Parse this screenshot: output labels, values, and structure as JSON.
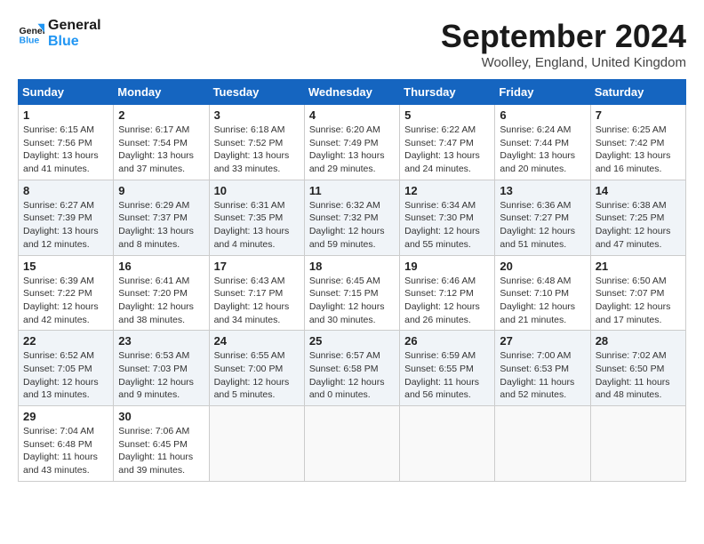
{
  "logo": {
    "line1": "General",
    "line2": "Blue"
  },
  "title": "September 2024",
  "location": "Woolley, England, United Kingdom",
  "days_of_week": [
    "Sunday",
    "Monday",
    "Tuesday",
    "Wednesday",
    "Thursday",
    "Friday",
    "Saturday"
  ],
  "weeks": [
    [
      {
        "day": "1",
        "sunrise": "6:15 AM",
        "sunset": "7:56 PM",
        "daylight": "13 hours and 41 minutes."
      },
      {
        "day": "2",
        "sunrise": "6:17 AM",
        "sunset": "7:54 PM",
        "daylight": "13 hours and 37 minutes."
      },
      {
        "day": "3",
        "sunrise": "6:18 AM",
        "sunset": "7:52 PM",
        "daylight": "13 hours and 33 minutes."
      },
      {
        "day": "4",
        "sunrise": "6:20 AM",
        "sunset": "7:49 PM",
        "daylight": "13 hours and 29 minutes."
      },
      {
        "day": "5",
        "sunrise": "6:22 AM",
        "sunset": "7:47 PM",
        "daylight": "13 hours and 24 minutes."
      },
      {
        "day": "6",
        "sunrise": "6:24 AM",
        "sunset": "7:44 PM",
        "daylight": "13 hours and 20 minutes."
      },
      {
        "day": "7",
        "sunrise": "6:25 AM",
        "sunset": "7:42 PM",
        "daylight": "13 hours and 16 minutes."
      }
    ],
    [
      {
        "day": "8",
        "sunrise": "6:27 AM",
        "sunset": "7:39 PM",
        "daylight": "13 hours and 12 minutes."
      },
      {
        "day": "9",
        "sunrise": "6:29 AM",
        "sunset": "7:37 PM",
        "daylight": "13 hours and 8 minutes."
      },
      {
        "day": "10",
        "sunrise": "6:31 AM",
        "sunset": "7:35 PM",
        "daylight": "13 hours and 4 minutes."
      },
      {
        "day": "11",
        "sunrise": "6:32 AM",
        "sunset": "7:32 PM",
        "daylight": "12 hours and 59 minutes."
      },
      {
        "day": "12",
        "sunrise": "6:34 AM",
        "sunset": "7:30 PM",
        "daylight": "12 hours and 55 minutes."
      },
      {
        "day": "13",
        "sunrise": "6:36 AM",
        "sunset": "7:27 PM",
        "daylight": "12 hours and 51 minutes."
      },
      {
        "day": "14",
        "sunrise": "6:38 AM",
        "sunset": "7:25 PM",
        "daylight": "12 hours and 47 minutes."
      }
    ],
    [
      {
        "day": "15",
        "sunrise": "6:39 AM",
        "sunset": "7:22 PM",
        "daylight": "12 hours and 42 minutes."
      },
      {
        "day": "16",
        "sunrise": "6:41 AM",
        "sunset": "7:20 PM",
        "daylight": "12 hours and 38 minutes."
      },
      {
        "day": "17",
        "sunrise": "6:43 AM",
        "sunset": "7:17 PM",
        "daylight": "12 hours and 34 minutes."
      },
      {
        "day": "18",
        "sunrise": "6:45 AM",
        "sunset": "7:15 PM",
        "daylight": "12 hours and 30 minutes."
      },
      {
        "day": "19",
        "sunrise": "6:46 AM",
        "sunset": "7:12 PM",
        "daylight": "12 hours and 26 minutes."
      },
      {
        "day": "20",
        "sunrise": "6:48 AM",
        "sunset": "7:10 PM",
        "daylight": "12 hours and 21 minutes."
      },
      {
        "day": "21",
        "sunrise": "6:50 AM",
        "sunset": "7:07 PM",
        "daylight": "12 hours and 17 minutes."
      }
    ],
    [
      {
        "day": "22",
        "sunrise": "6:52 AM",
        "sunset": "7:05 PM",
        "daylight": "12 hours and 13 minutes."
      },
      {
        "day": "23",
        "sunrise": "6:53 AM",
        "sunset": "7:03 PM",
        "daylight": "12 hours and 9 minutes."
      },
      {
        "day": "24",
        "sunrise": "6:55 AM",
        "sunset": "7:00 PM",
        "daylight": "12 hours and 5 minutes."
      },
      {
        "day": "25",
        "sunrise": "6:57 AM",
        "sunset": "6:58 PM",
        "daylight": "12 hours and 0 minutes."
      },
      {
        "day": "26",
        "sunrise": "6:59 AM",
        "sunset": "6:55 PM",
        "daylight": "11 hours and 56 minutes."
      },
      {
        "day": "27",
        "sunrise": "7:00 AM",
        "sunset": "6:53 PM",
        "daylight": "11 hours and 52 minutes."
      },
      {
        "day": "28",
        "sunrise": "7:02 AM",
        "sunset": "6:50 PM",
        "daylight": "11 hours and 48 minutes."
      }
    ],
    [
      {
        "day": "29",
        "sunrise": "7:04 AM",
        "sunset": "6:48 PM",
        "daylight": "11 hours and 43 minutes."
      },
      {
        "day": "30",
        "sunrise": "7:06 AM",
        "sunset": "6:45 PM",
        "daylight": "11 hours and 39 minutes."
      },
      null,
      null,
      null,
      null,
      null
    ]
  ]
}
